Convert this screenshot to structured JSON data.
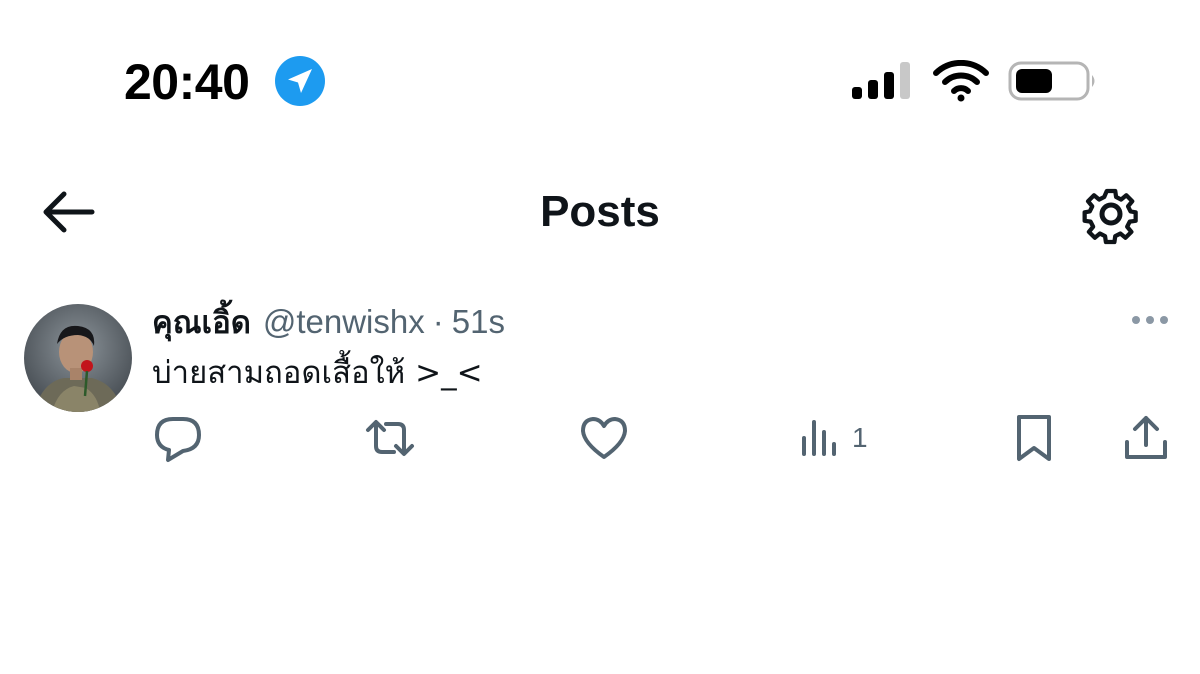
{
  "status_bar": {
    "time": "20:40",
    "icons": [
      "location-arrow-icon",
      "cellular-signal-icon",
      "wifi-icon",
      "battery-icon"
    ],
    "location_color": "#1d9bf0"
  },
  "header": {
    "title": "Posts",
    "left_icon": "back-arrow-icon",
    "right_icon": "settings-gear-icon"
  },
  "post": {
    "display_name": "คุณเอิ้ด",
    "handle": "@tenwishx",
    "separator": "·",
    "time": "51s",
    "text": "บ่ายสามถอดเสื้อให้ >_<",
    "views": "1",
    "actions": [
      "reply-icon",
      "repost-icon",
      "like-icon",
      "views-icon",
      "bookmark-icon",
      "share-icon"
    ]
  },
  "colors": {
    "text_primary": "#0f1419",
    "text_secondary": "#536471",
    "accent": "#1d9bf0"
  }
}
